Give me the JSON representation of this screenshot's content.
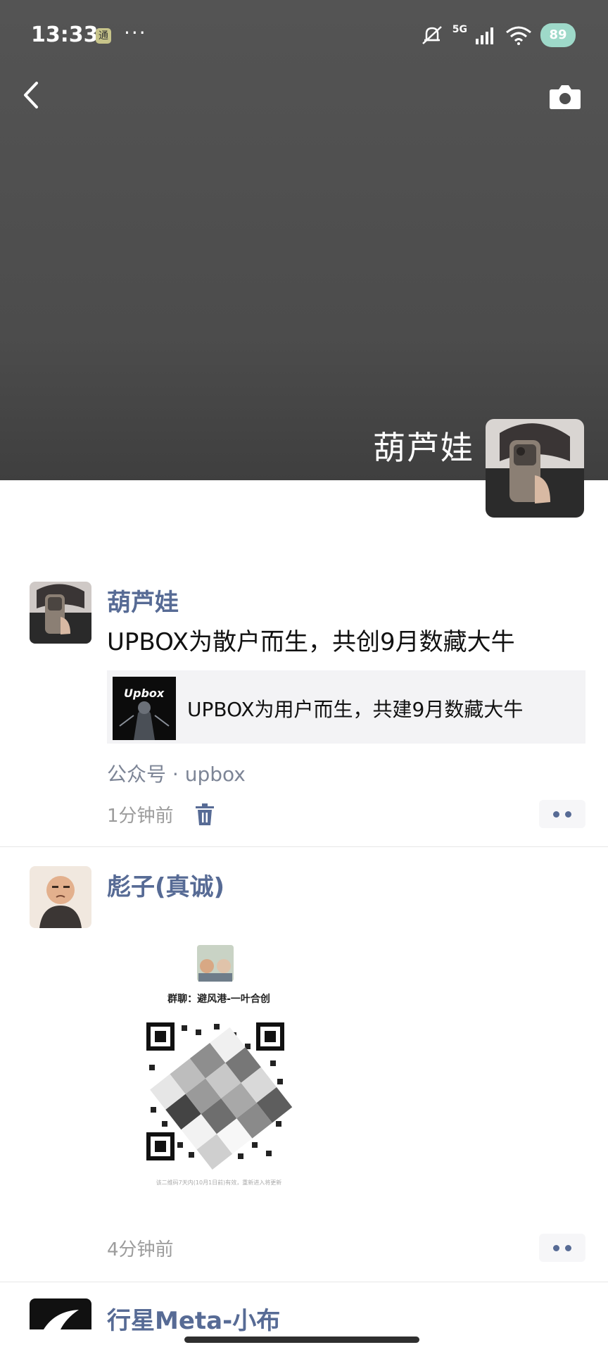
{
  "status_bar": {
    "time": "13:33",
    "app_icon": "通",
    "dots": "···",
    "network": "5G",
    "battery": "89"
  },
  "header": {
    "profile_name": "葫芦娃"
  },
  "posts": [
    {
      "author": "葫芦娃",
      "text": "UPBOX为散户而生，共创9月数藏大牛",
      "share_card": {
        "thumb_text": "Upbox",
        "title": "UPBOX为用户而生，共建9月数藏大牛"
      },
      "source": "公众号 · upbox",
      "time": "1分钟前"
    },
    {
      "author": "彪子(真诚)",
      "qr": {
        "group_label": "群聊：避风港-一叶合创",
        "footnote": "该二维码7天内(10月1日前)有效，重新进入将更新"
      },
      "time": "4分钟前"
    },
    {
      "author": "行星Meta-小布"
    }
  ],
  "icons": {
    "back": "chevron-left-icon",
    "camera": "camera-icon",
    "trash": "trash-icon",
    "more": "more-dots-icon"
  },
  "colors": {
    "author_link": "#576b95",
    "cover": "#4c4c4c"
  }
}
